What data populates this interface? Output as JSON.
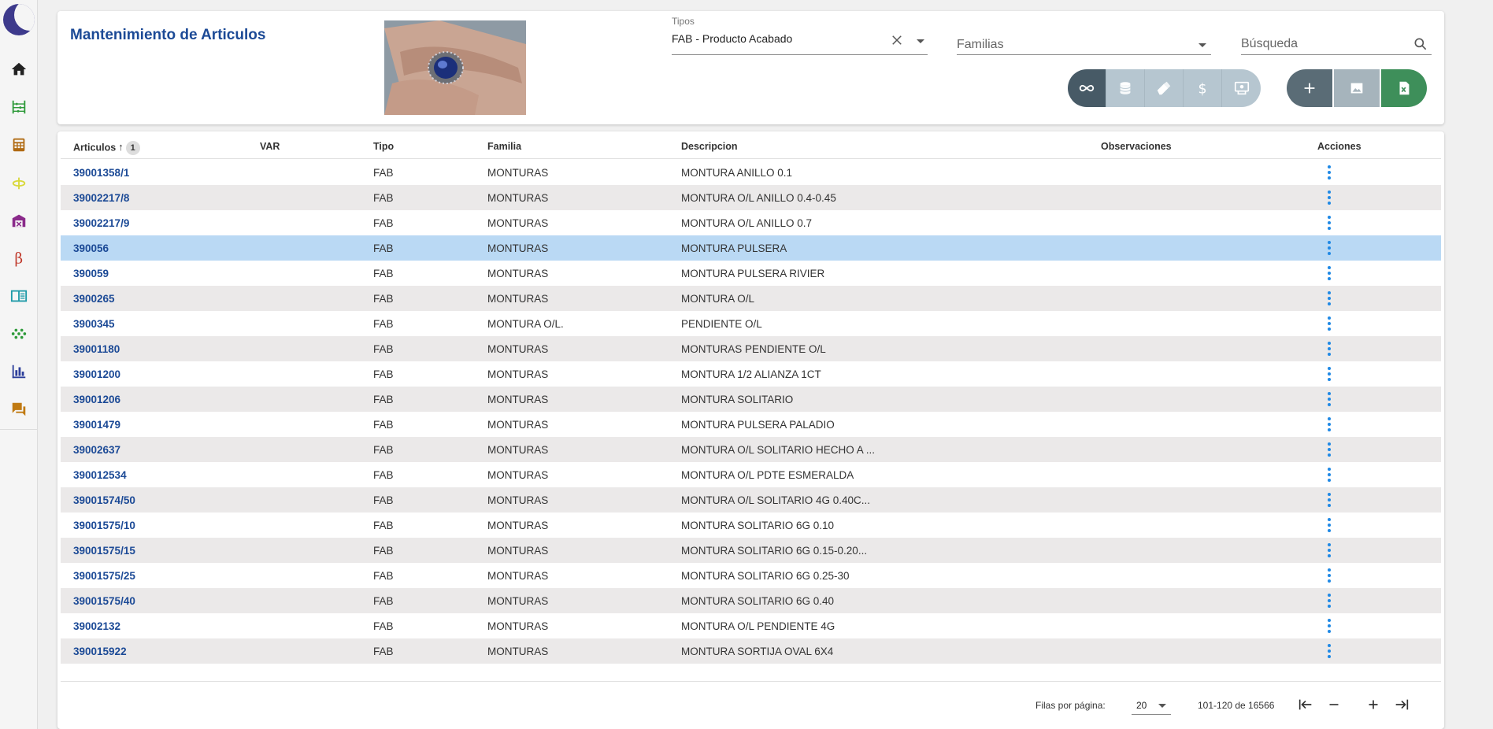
{
  "sidebar": {
    "items": [
      {
        "icon": "home-icon",
        "color": "#222222"
      },
      {
        "icon": "abacus-icon",
        "color": "#2e9a3a"
      },
      {
        "icon": "calculator-icon",
        "color": "#b06a12"
      },
      {
        "icon": "ring-icon",
        "color": "#d8d83a"
      },
      {
        "icon": "warehouse-icon",
        "color": "#8a2a8a"
      },
      {
        "icon": "beta-icon",
        "color": "#c0392b"
      },
      {
        "icon": "book-icon",
        "color": "#1e9aa8"
      },
      {
        "icon": "grid-dots-icon",
        "color": "#2e9a3a"
      },
      {
        "icon": "bar-chart-icon",
        "color": "#2c3e9a"
      },
      {
        "icon": "chat-icon",
        "color": "#c07a12"
      }
    ]
  },
  "header": {
    "title": "Mantenimiento de Articulos",
    "tipos": {
      "label": "Tipos",
      "value": "FAB  -  Producto Acabado"
    },
    "familias": {
      "placeholder": "Familias"
    },
    "search": {
      "placeholder": "Búsqueda"
    },
    "toggles": [
      {
        "icon": "infinity-icon",
        "active": true
      },
      {
        "icon": "database-icon",
        "active": false
      },
      {
        "icon": "eraser-icon",
        "active": false
      },
      {
        "icon": "dollar-icon",
        "active": false
      },
      {
        "icon": "cash-register-icon",
        "active": false
      }
    ],
    "actions": [
      {
        "icon": "plus-icon"
      },
      {
        "icon": "image-icon"
      },
      {
        "icon": "excel-icon"
      }
    ]
  },
  "table": {
    "columns": {
      "articulos": "Articulos",
      "sort_badge": "1",
      "var": "VAR",
      "tipo": "Tipo",
      "familia": "Familia",
      "descripcion": "Descripcion",
      "observaciones": "Observaciones",
      "acciones": "Acciones"
    },
    "rows": [
      {
        "code": "39001358/1",
        "var": "",
        "tipo": "FAB",
        "familia": "MONTURAS",
        "descripcion": "MONTURA ANILLO 0.1",
        "observaciones": ""
      },
      {
        "code": "39002217/8",
        "var": "",
        "tipo": "FAB",
        "familia": "MONTURAS",
        "descripcion": "MONTURA O/L ANILLO 0.4-0.45",
        "observaciones": ""
      },
      {
        "code": "39002217/9",
        "var": "",
        "tipo": "FAB",
        "familia": "MONTURAS",
        "descripcion": "MONTURA O/L ANILLO 0.7",
        "observaciones": ""
      },
      {
        "code": "390056",
        "var": "",
        "tipo": "FAB",
        "familia": "MONTURAS",
        "descripcion": "MONTURA PULSERA",
        "observaciones": "",
        "selected": true
      },
      {
        "code": "390059",
        "var": "",
        "tipo": "FAB",
        "familia": "MONTURAS",
        "descripcion": "MONTURA PULSERA RIVIER",
        "observaciones": ""
      },
      {
        "code": "3900265",
        "var": "",
        "tipo": "FAB",
        "familia": "MONTURAS",
        "descripcion": "MONTURA O/L",
        "observaciones": ""
      },
      {
        "code": "3900345",
        "var": "",
        "tipo": "FAB",
        "familia": "MONTURA O/L.",
        "descripcion": "PENDIENTE O/L",
        "observaciones": ""
      },
      {
        "code": "39001180",
        "var": "",
        "tipo": "FAB",
        "familia": "MONTURAS",
        "descripcion": "MONTURAS PENDIENTE O/L",
        "observaciones": ""
      },
      {
        "code": "39001200",
        "var": "",
        "tipo": "FAB",
        "familia": "MONTURAS",
        "descripcion": "MONTURA 1/2 ALIANZA 1CT",
        "observaciones": ""
      },
      {
        "code": "39001206",
        "var": "",
        "tipo": "FAB",
        "familia": "MONTURAS",
        "descripcion": "MONTURA SOLITARIO",
        "observaciones": ""
      },
      {
        "code": "39001479",
        "var": "",
        "tipo": "FAB",
        "familia": "MONTURAS",
        "descripcion": "MONTURA PULSERA PALADIO",
        "observaciones": ""
      },
      {
        "code": "39002637",
        "var": "",
        "tipo": "FAB",
        "familia": "MONTURAS",
        "descripcion": "MONTURA O/L SOLITARIO HECHO A ...",
        "observaciones": ""
      },
      {
        "code": "390012534",
        "var": "",
        "tipo": "FAB",
        "familia": "MONTURAS",
        "descripcion": "MONTURA O/L PDTE ESMERALDA",
        "observaciones": ""
      },
      {
        "code": "39001574/50",
        "var": "",
        "tipo": "FAB",
        "familia": "MONTURAS",
        "descripcion": "MONTURA O/L SOLITARIO 4G 0.40C...",
        "observaciones": ""
      },
      {
        "code": "39001575/10",
        "var": "",
        "tipo": "FAB",
        "familia": "MONTURAS",
        "descripcion": "MONTURA SOLITARIO 6G 0.10",
        "observaciones": ""
      },
      {
        "code": "39001575/15",
        "var": "",
        "tipo": "FAB",
        "familia": "MONTURAS",
        "descripcion": "MONTURA SOLITARIO 6G 0.15-0.20...",
        "observaciones": ""
      },
      {
        "code": "39001575/25",
        "var": "",
        "tipo": "FAB",
        "familia": "MONTURAS",
        "descripcion": "MONTURA SOLITARIO 6G 0.25-30",
        "observaciones": ""
      },
      {
        "code": "39001575/40",
        "var": "",
        "tipo": "FAB",
        "familia": "MONTURAS",
        "descripcion": "MONTURA SOLITARIO 6G 0.40",
        "observaciones": ""
      },
      {
        "code": "39002132",
        "var": "",
        "tipo": "FAB",
        "familia": "MONTURAS",
        "descripcion": "MONTURA O/L PENDIENTE 4G",
        "observaciones": ""
      },
      {
        "code": "390015922",
        "var": "",
        "tipo": "FAB",
        "familia": "MONTURAS",
        "descripcion": "MONTURA SORTIJA OVAL 6X4",
        "observaciones": ""
      }
    ]
  },
  "pagination": {
    "rows_per_page_label": "Filas por página:",
    "rows_per_page": "20",
    "range": "101-120 de 16566"
  },
  "colors": {
    "accent": "#1c4a96",
    "selected_row": "#bad9f4",
    "striped_row": "#ebe9e9",
    "menu_dots": "#1e88e5"
  }
}
